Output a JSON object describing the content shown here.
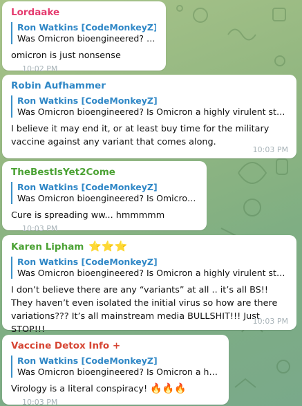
{
  "messages": [
    {
      "sender": "Lordaake",
      "sender_color": "#e53b6f",
      "quote_author": "Ron Watkins [CodeMonkeyZ]",
      "quote_text": "Was Omicron bioengineered? Is ...",
      "text": "omicron is just nonsense",
      "time": "10:02 PM"
    },
    {
      "sender": "Robin Aufhammer",
      "sender_color": "#2f87c6",
      "quote_author": "Ron Watkins [CodeMonkeyZ]",
      "quote_text": "Was Omicron bioengineered? Is Omicron a highly virulent strain ...",
      "text": "I believe it may end it, or at least buy time for the military vaccine against any variant that comes along.",
      "time": "10:03 PM"
    },
    {
      "sender": "TheBestIsYet2Come",
      "sender_color": "#4ba234",
      "quote_author": "Ron Watkins [CodeMonkeyZ]",
      "quote_text": "Was Omicron bioengineered? Is Omicron ...",
      "text": "Cure is spreading ww... hmmmmm",
      "time": "10:03 PM"
    },
    {
      "sender": "Karen Lipham",
      "sender_emoji": "⭐⭐⭐",
      "sender_color": "#4ba234",
      "quote_author": "Ron Watkins [CodeMonkeyZ]",
      "quote_text": "Was Omicron bioengineered? Is Omicron a highly virulent strain ...",
      "text": "I don’t believe there are any “variants” at all .. it’s all BS!! They haven’t even isolated the initial virus so how are there variations??? It’s all mainstream media BULLSHIT!!! Just STOP!!!",
      "time": "10:03 PM"
    },
    {
      "sender": "Vaccine Detox Info +",
      "sender_color": "#d64533",
      "quote_author": "Ron Watkins [CodeMonkeyZ]",
      "quote_text": "Was Omicron bioengineered? Is Omicron a highl...",
      "text": "Virology is a literal conspiracy!",
      "text_emoji": "🔥🔥🔥",
      "time": "10:03 PM"
    }
  ]
}
